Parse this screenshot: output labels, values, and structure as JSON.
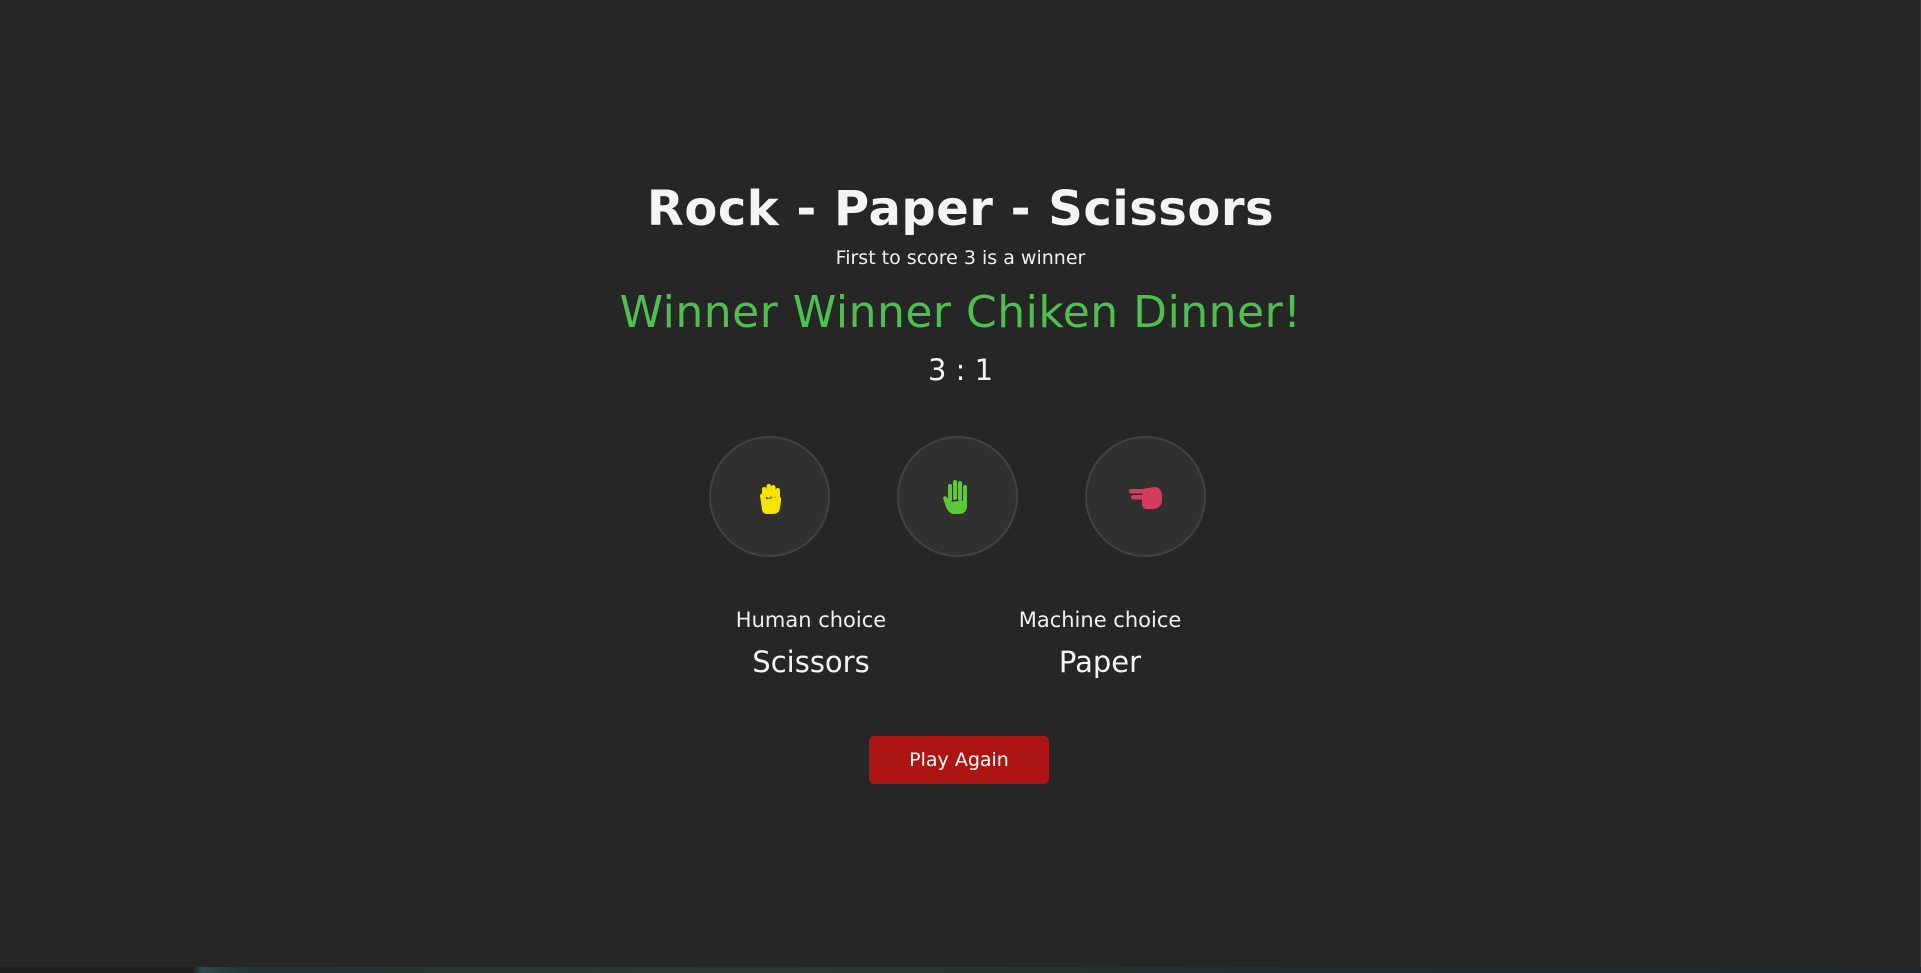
{
  "game": {
    "title": "Rock - Paper - Scissors",
    "subtitle": "First to score 3 is a winner",
    "result_message": "Winner Winner Chiken Dinner!",
    "score": "3 : 1",
    "result_color": "#4fbf4f"
  },
  "choices": [
    {
      "name": "rock",
      "icon": "fist-icon",
      "color": "#f5e400"
    },
    {
      "name": "paper",
      "icon": "open-hand-icon",
      "color": "#5cc937"
    },
    {
      "name": "scissors",
      "icon": "scissors-hand-icon",
      "color": "#d63c5e"
    }
  ],
  "human": {
    "label": "Human choice",
    "value": "Scissors"
  },
  "machine": {
    "label": "Machine choice",
    "value": "Paper"
  },
  "actions": {
    "play_again_label": "Play Again",
    "play_again_color": "#ad1414"
  }
}
